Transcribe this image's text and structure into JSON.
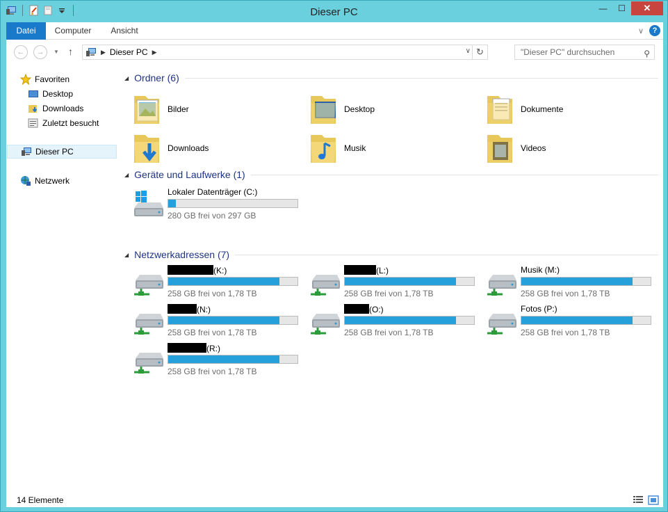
{
  "window": {
    "title": "Dieser PC",
    "close_label": "✕",
    "minimize_label": "—",
    "maximize_label": "☐"
  },
  "ribbon": {
    "tabs": [
      "Datei",
      "Computer",
      "Ansicht"
    ]
  },
  "address": {
    "crumb": "Dieser PC",
    "search_placeholder": "\"Dieser PC\" durchsuchen"
  },
  "nav": {
    "favorites": "Favoriten",
    "desktop": "Desktop",
    "downloads": "Downloads",
    "recent": "Zuletzt besucht",
    "thispc": "Dieser PC",
    "network": "Netzwerk"
  },
  "groups": {
    "folders": "Ordner (6)",
    "devices": "Geräte und Laufwerke (1)",
    "network": "Netzwerkadressen (7)"
  },
  "folders": [
    "Bilder",
    "Desktop",
    "Dokumente",
    "Downloads",
    "Musik",
    "Videos"
  ],
  "local_drive": {
    "name": "Lokaler Datenträger (C:)",
    "free": "280 GB frei von 297 GB",
    "used_fraction": 0.06
  },
  "network_drives": [
    {
      "label": "(K:)",
      "free": "258 GB frei von 1,78 TB",
      "used_fraction": 0.86,
      "redacted": true
    },
    {
      "label": "(L:)",
      "free": "258 GB frei von 1,78 TB",
      "used_fraction": 0.86,
      "redacted": true
    },
    {
      "label": "Musik (M:)",
      "free": "258 GB frei von 1,78 TB",
      "used_fraction": 0.86,
      "redacted": false
    },
    {
      "label": "(N:)",
      "free": "258 GB frei von 1,78 TB",
      "used_fraction": 0.86,
      "redacted": true
    },
    {
      "label": "(O:)",
      "free": "258 GB frei von 1,78 TB",
      "used_fraction": 0.86,
      "redacted": true
    },
    {
      "label": "Fotos (P:)",
      "free": "258 GB frei von 1,78 TB",
      "used_fraction": 0.86,
      "redacted": false
    },
    {
      "label": "(R:)",
      "free": "258 GB frei von 1,78 TB",
      "used_fraction": 0.86,
      "redacted": true
    }
  ],
  "status": {
    "count": "14 Elemente"
  },
  "colors": {
    "frame": "#6bd0de",
    "accent": "#1979ca",
    "group_header": "#1e3287",
    "bar_fill": "#26a0da"
  }
}
